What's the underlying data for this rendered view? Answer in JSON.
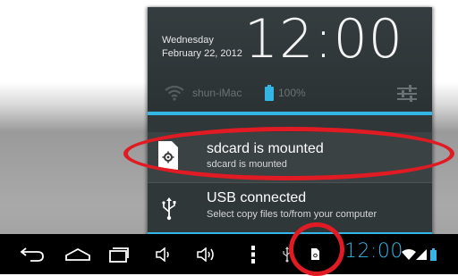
{
  "header": {
    "weekday": "Wednesday",
    "date": "February 22, 2012",
    "clock": "12:00",
    "network_name": "shun-iMac",
    "battery_percent": "100%"
  },
  "notifications": [
    {
      "title": "sdcard is mounted",
      "subtitle": "sdcard is mounted",
      "icon": "sdcard-icon"
    },
    {
      "title": "USB connected",
      "subtitle": "Select copy files to/from your computer",
      "icon": "usb-icon"
    }
  ],
  "system_bar": {
    "clock": "12:00",
    "nav_buttons": [
      "back-icon",
      "home-icon",
      "recent-apps-icon",
      "volume-down-icon",
      "volume-up-icon",
      "menu-icon"
    ],
    "status_icons": [
      "usb-icon",
      "sdcard-icon",
      "wifi-icon",
      "signal-icon",
      "battery-icon"
    ]
  },
  "colors": {
    "accent": "#33b5e5",
    "annotation": "#e01b24",
    "panel": "#303739"
  }
}
